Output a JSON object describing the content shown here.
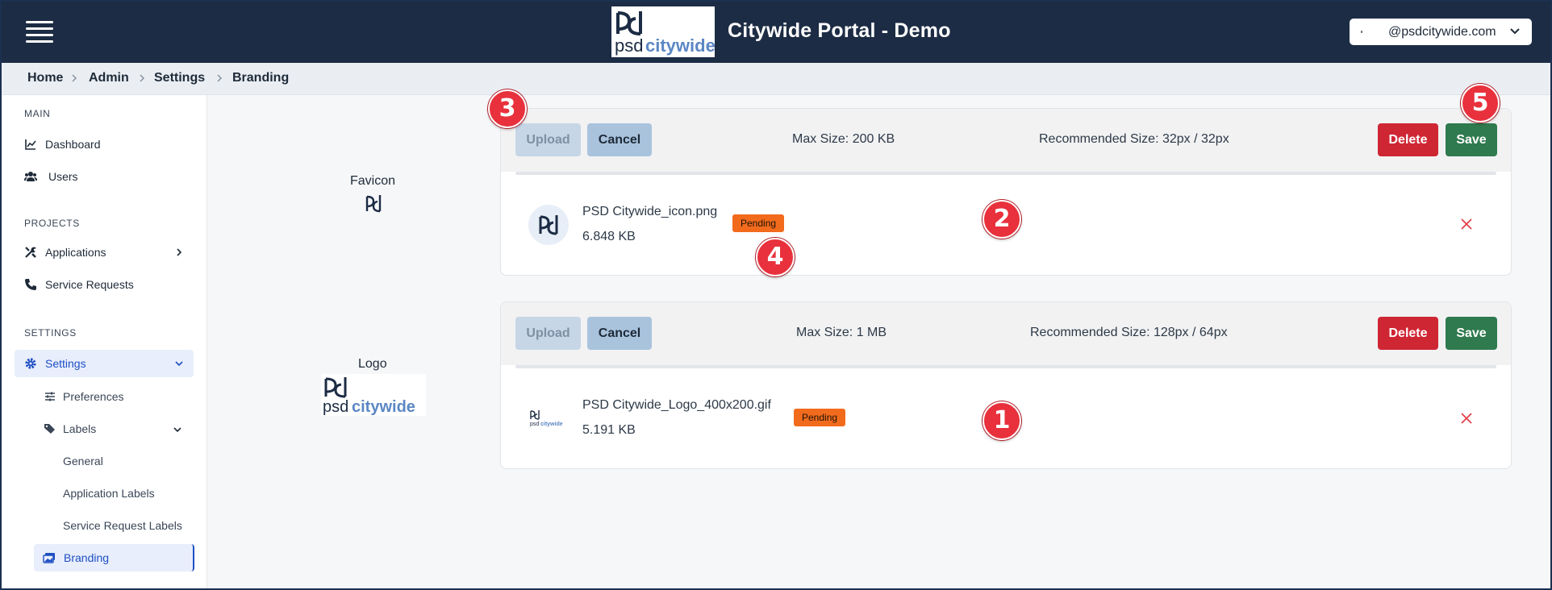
{
  "header": {
    "title": "Citywide Portal - Demo",
    "logo_text_psd": "psd",
    "logo_text_citywide": "citywide",
    "user_email": "@psdcitywide.com",
    "menu_icon": "hamburger-menu-icon",
    "background": "#1c2c44"
  },
  "breadcrumb": {
    "items": [
      "Home",
      "Admin",
      "Settings",
      "Branding"
    ]
  },
  "sidebar": {
    "sections": {
      "main": "MAIN",
      "projects": "PROJECTS",
      "settings": "SETTINGS"
    },
    "items": {
      "dashboard": "Dashboard",
      "users": "Users",
      "applications": "Applications",
      "service_requests": "Service Requests",
      "settings": "Settings",
      "preferences": "Preferences",
      "labels": "Labels",
      "general": "General",
      "application_labels": "Application Labels",
      "service_request_labels": "Service Request Labels",
      "branding": "Branding"
    },
    "accent": "#1e4fc4"
  },
  "favicon_panel": {
    "preview_label": "Favicon",
    "upload": "Upload",
    "cancel": "Cancel",
    "max_size": "Max Size: 200 KB",
    "recommended_size": "Recommended Size: 32px / 32px",
    "delete": "Delete",
    "save": "Save",
    "file": {
      "name": "PSD Citywide_icon.png",
      "size": "6.848 KB",
      "status": "Pending"
    }
  },
  "logo_panel": {
    "preview_label": "Logo",
    "upload": "Upload",
    "cancel": "Cancel",
    "max_size": "Max Size: 1 MB",
    "recommended_size": "Recommended Size: 128px / 64px",
    "delete": "Delete",
    "save": "Save",
    "file": {
      "name": "PSD Citywide_Logo_400x200.gif",
      "size": "5.191 KB",
      "status": "Pending"
    }
  },
  "callouts": [
    "1",
    "2",
    "3",
    "4",
    "5"
  ],
  "colors": {
    "delete": "#cf2634",
    "save": "#2f7a4e",
    "pending": "#f26b1d",
    "callout": "#e8313c"
  }
}
